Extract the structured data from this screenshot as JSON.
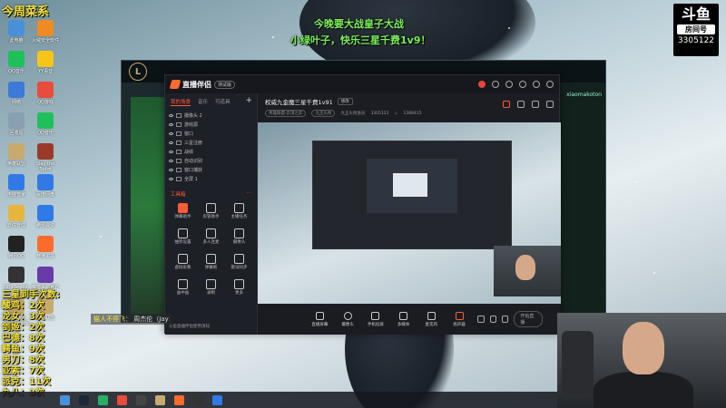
{
  "overlay": {
    "top_yellow": "今周菜系",
    "center_line1": "今晚要大战皇子大战",
    "center_line2": "小绿叶子，快乐三星千费1v9！"
  },
  "brand": {
    "logo": "斗鱼",
    "sub": "房间号",
    "room_no": "3305122"
  },
  "desktop_icons": [
    {
      "label": "此电脑",
      "color": "#4a90d9"
    },
    {
      "label": "火绒安全软件",
      "color": "#f08a24"
    },
    {
      "label": "QQ音乐",
      "color": "#1ec05a"
    },
    {
      "label": "YY语音",
      "color": "#f5c518"
    },
    {
      "label": "网络",
      "color": "#3b7ad8"
    },
    {
      "label": "QQ游戏",
      "color": "#e94b3c"
    },
    {
      "label": "回收站",
      "color": "#8aa0b0"
    },
    {
      "label": "QQ音乐",
      "color": "#1ec05a"
    },
    {
      "label": "英雄联盟",
      "color": "#c8aa6e"
    },
    {
      "label": "Slay the Spire",
      "color": "#9c3a2a"
    },
    {
      "label": "电脑管家",
      "color": "#2f7ae5"
    },
    {
      "label": "百度网盘",
      "color": "#2f7ae5"
    },
    {
      "label": "软件管理",
      "color": "#e6b63c"
    },
    {
      "label": "腾讯会议",
      "color": "#2f7ae5"
    },
    {
      "label": "腾讯QQ",
      "color": "#222"
    },
    {
      "label": "开播工具",
      "color": "#ff6b2c"
    },
    {
      "label": "OBS Studio",
      "color": "#333"
    },
    {
      "label": "魔兽争霸官方对战平台",
      "color": "#6a3aa8"
    },
    {
      "label": "英雄联盟WeGame版",
      "color": "#c8aa6e"
    },
    {
      "label": "英雄联盟",
      "color": "#c8aa6e"
    }
  ],
  "game_window": {
    "right_tag": "xiaomakoton"
  },
  "app": {
    "name": "直播伴侣",
    "version_pill": "测试版",
    "left_tabs": [
      "我的场景",
      "音乐",
      "可道具"
    ],
    "scenes": [
      "摄像头 2",
      "游戏源",
      "窗口",
      "三星注册",
      "战绩",
      "自动识别",
      "窗口捕获",
      "全屏 1"
    ],
    "tools_title": "工具箱",
    "tools": [
      "弹幕助手",
      "房管助手",
      "主播任务",
      "抽奖设置",
      "多人连麦",
      "摄像头",
      "虚拟形象",
      "弹幕姬",
      "歌词同步",
      "画中画",
      "录制",
      "更多"
    ],
    "bottom_notice": "斗鱼直播伴侣使用须知"
  },
  "room": {
    "title": "权威九金魔三星千费1v91",
    "edit_label": "修改",
    "category_chip": "英雄联盟·云顶之弈",
    "level_chip": "九王头衔",
    "owner_tag": "九王头衔会员",
    "room_id": "3305122",
    "viewers": "1388415"
  },
  "controls": [
    "直播屏幕",
    "摄像头",
    "手机投屏",
    "多媒体",
    "麦克风",
    "扬声器"
  ],
  "start_label": "开始直播",
  "counts": [
    "三星到手次数:",
    "酸鸡：2次",
    "龙女：3次",
    "剑姬：2次",
    "巴德：8次",
    "鳄鱼：9次",
    "男刀：8次",
    "亚索：7次",
    "派克：11次",
    "九八：3次"
  ],
  "chat": {
    "name": "猫人不停飞",
    "text": "周杰伦（Jay"
  },
  "taskbar_icons": [
    {
      "name": "start",
      "color": "#4a90d9"
    },
    {
      "name": "steam",
      "color": "#1b2838"
    },
    {
      "name": "wechat",
      "color": "#2aae67"
    },
    {
      "name": "streamer",
      "color": "#e94b3c"
    },
    {
      "name": "app",
      "color": "#444"
    },
    {
      "name": "lol",
      "color": "#c8aa6e"
    },
    {
      "name": "live",
      "color": "#ff6b2c"
    },
    {
      "name": "chat",
      "color": "#333"
    },
    {
      "name": "browser",
      "color": "#2f7ae5"
    }
  ]
}
